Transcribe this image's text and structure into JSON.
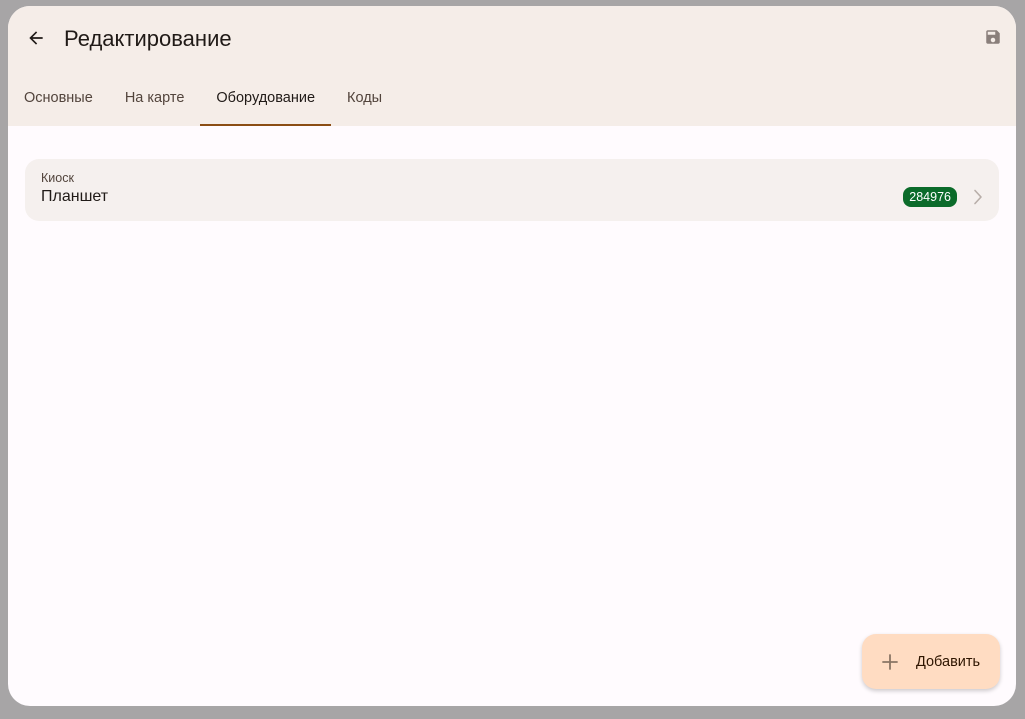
{
  "header": {
    "title": "Редактирование",
    "back_icon": "arrow-back-icon",
    "save_icon": "save-icon"
  },
  "tabs": [
    {
      "label": "Основные",
      "active": false
    },
    {
      "label": "На карте",
      "active": false
    },
    {
      "label": "Оборудование",
      "active": true
    },
    {
      "label": "Коды",
      "active": false
    }
  ],
  "equipment": {
    "items": [
      {
        "type": "Киоск",
        "name": "Планшет",
        "code": "284976"
      }
    ]
  },
  "fab": {
    "label": "Добавить",
    "icon": "plus-icon"
  },
  "colors": {
    "header_bg": "#f5ede8",
    "accent": "#8b4d14",
    "badge_bg": "#0b6b2a",
    "fab_bg": "#ffdcc2"
  }
}
